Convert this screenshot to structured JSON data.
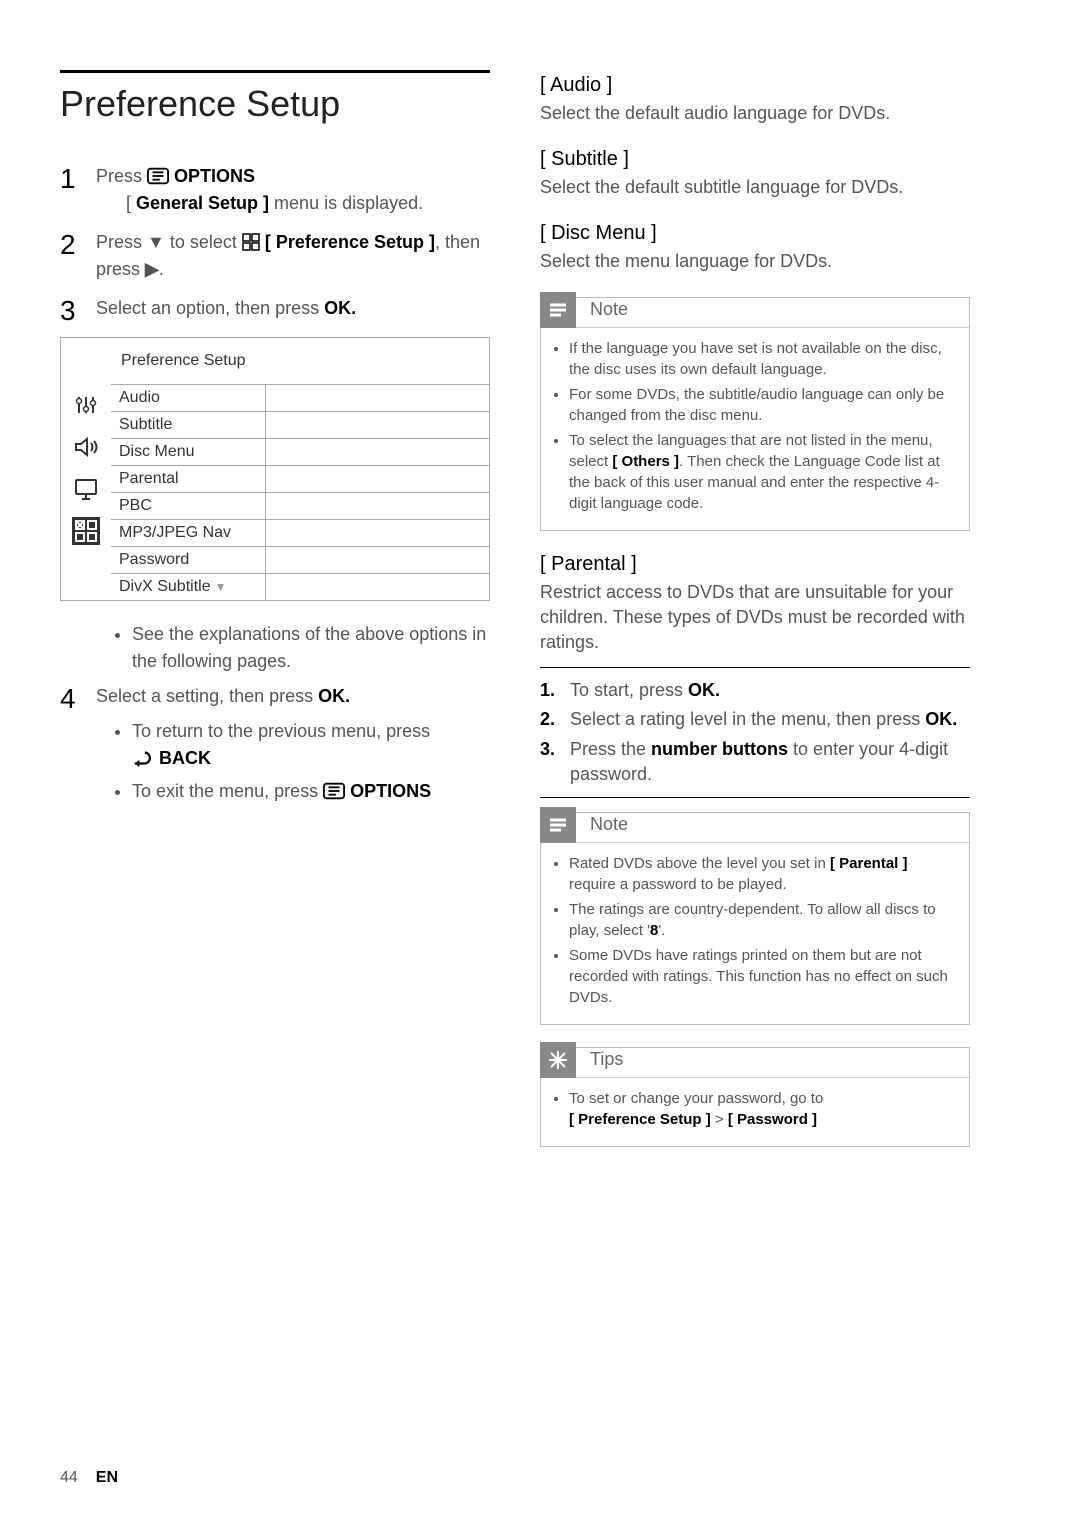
{
  "page": {
    "title": "Preference Setup",
    "footer_page": "44",
    "footer_lang": "EN"
  },
  "steps": {
    "s1": {
      "press": "Press",
      "options_label": "OPTIONS",
      "result_pre": "[ ",
      "result_menu": "General Setup ]",
      "result_post": " menu is displayed."
    },
    "s2": {
      "press": "Press ",
      "to_select": " to select ",
      "pref_label": "[ Preference Setup ]",
      "then": ", then press "
    },
    "s3": {
      "text": "Select an option, then press ",
      "ok": "OK."
    },
    "s4": {
      "text": "Select a setting, then press ",
      "ok": "OK."
    }
  },
  "menu": {
    "header": "Preference Setup",
    "rows": [
      "Audio",
      "Subtitle",
      "Disc Menu",
      "Parental",
      "PBC",
      "MP3/JPEG Nav",
      "Password",
      "DivX Subtitle"
    ]
  },
  "after_menu": {
    "bullet": "See the explanations of the above options in the following pages."
  },
  "return_exit": {
    "return_text": "To return to the previous menu, press",
    "back_label": "BACK",
    "exit_text": "To exit the menu, press ",
    "options_label": "OPTIONS"
  },
  "right": {
    "audio": {
      "title": "[ Audio ]",
      "desc": "Select the default audio language for DVDs."
    },
    "subtitle": {
      "title": "[ Subtitle ]",
      "desc": "Select the default subtitle language for DVDs."
    },
    "discmenu": {
      "title": "[ Disc Menu ]",
      "desc": "Select the menu language for DVDs."
    },
    "parental": {
      "title": "[ Parental ]",
      "desc": "Restrict access to DVDs that are unsuitable for your children.  These types of DVDs must be recorded with ratings."
    }
  },
  "note1": {
    "label": "Note",
    "items": [
      "If the language you have set is not available on the disc, the disc uses its own default language.",
      "For some DVDs, the subtitle/audio language can only be changed from the disc menu.",
      "To select the languages that are not listed in the menu, select [ Others ].  Then check the Language Code list at the back of this user manual and enter the respective 4-digit language code."
    ],
    "others_bold": "[ Others ]"
  },
  "parental_steps": {
    "s1_a": "To start, press ",
    "s1_b": "OK.",
    "s2_a": "Select a rating level in the menu, then press ",
    "s2_b": "OK.",
    "s3_a": "Press the ",
    "s3_b": "number buttons",
    "s3_c": " to enter your 4-digit password."
  },
  "note2": {
    "label": "Note",
    "items_html": {
      "i1_a": "Rated DVDs above the level you set in ",
      "i1_b": "[ Parental ]",
      "i1_c": " require a password to be played.",
      "i2_a": "The ratings are country-dependent. To allow all discs to play, select '",
      "i2_b": "8",
      "i2_c": "'.",
      "i3": "Some DVDs have ratings printed on them but are not recorded with ratings.  This function has no effect on such DVDs."
    }
  },
  "tips": {
    "label": "Tips",
    "t1_a": "To set or change your password, go to ",
    "t1_b": "[ Preference Setup ]",
    "t1_c": " > ",
    "t1_d": "[ Password ]"
  }
}
